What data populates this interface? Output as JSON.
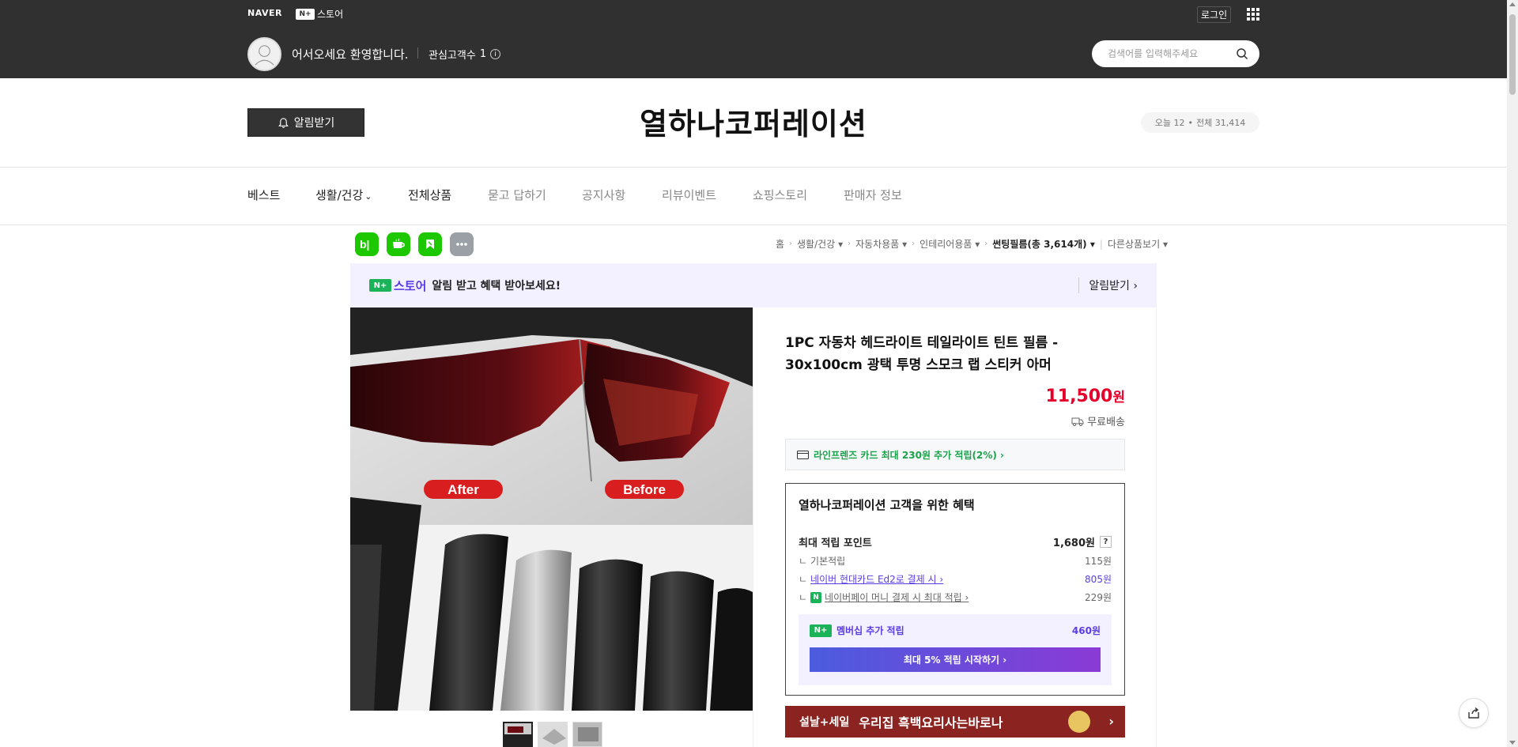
{
  "topbar": {
    "brand": "NAVER",
    "nplus_badge": "N+",
    "store_label": "스토어",
    "login": "로그인",
    "welcome": "어서오세요 환영합니다.",
    "fav_label": "관심고객수",
    "fav_count": "1",
    "search_placeholder": "검색어를 입력해주세요"
  },
  "header": {
    "bell_label": "알림받기",
    "store_title": "열하나코퍼레이션",
    "visits_today": "오늘 12",
    "visits_dot": "•",
    "visits_total": "전체 31,414"
  },
  "nav": {
    "items": [
      {
        "label": "베스트"
      },
      {
        "label": "생활/건강"
      },
      {
        "label": "전체상품"
      },
      {
        "label": "묻고 답하기"
      },
      {
        "label": "공지사항"
      },
      {
        "label": "리뷰이벤트"
      },
      {
        "label": "쇼핑스토리"
      },
      {
        "label": "판매자 정보"
      }
    ],
    "dropdown_caret": "⌄"
  },
  "round_icons": [
    {
      "label": "b|",
      "color": "#1ec800"
    },
    {
      "label": "☕",
      "color": "#1ec800"
    },
    {
      "label": "🔖",
      "color": "#1ec800"
    },
    {
      "label": "•••",
      "color": "#9aa0a6"
    }
  ],
  "breadcrumb": {
    "items": [
      "홈",
      "생활/건강",
      "자동차용품",
      "인테리어용품",
      "썬팅필름(총 3,614개)",
      "다른상품보기"
    ],
    "arrow": "›",
    "caret": "▾"
  },
  "notice": {
    "np_badge": "N+",
    "store": "스토어",
    "text": "알림 받고 혜택 받아보세요!",
    "button": "알림받기 ›"
  },
  "product": {
    "title": "1PC 자동차 헤드라이트 테일라이트 틴트 필름 - 30x100cm 광택 투명 스모크 랩 스티커 아머",
    "price": "11,500",
    "currency": "원",
    "delivery": "무료배송",
    "image_after": "After",
    "image_before": "Before",
    "card_offer": "라인프렌즈 카드 최대 230원 추가 적립(2%) ›"
  },
  "benefit": {
    "title": "열하나코퍼레이션 고객을 위한 혜택",
    "max_label": "최대 적립 포인트",
    "max_value": "1,680원",
    "help": "?",
    "rows": [
      {
        "label": "기본적립",
        "value": "115원"
      },
      {
        "label": "네이버 현대카드 Ed2로 결제 시 ›",
        "value": "805원"
      },
      {
        "label": "네이버페이 머니 결제 시 최대 적립 ›",
        "value": "229원"
      }
    ],
    "npay_badge": "N",
    "member_badge": "N+",
    "member_label": "멤버십 추가 적립",
    "member_value": "460원",
    "member_button": "최대 5% 적립 시작하기 ›"
  },
  "promo": {
    "tag": "설날+세일",
    "text": "우리집 흑백요리사는바로나",
    "arrow": "›"
  },
  "colors": {
    "topbar": "#303030",
    "price": "#e4002b",
    "naver_green": "#1ab359",
    "purple": "#5a3de6",
    "promo": "#8b2320"
  }
}
